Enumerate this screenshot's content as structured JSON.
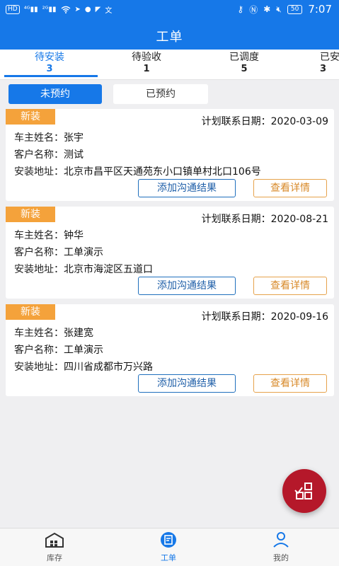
{
  "status_bar": {
    "left_items": [
      "HD",
      "4G",
      "26",
      "wifi",
      "msg",
      "send",
      "chat",
      "nav",
      "translate"
    ],
    "time": "7:07",
    "battery": "50"
  },
  "header": {
    "title": "工单"
  },
  "tabs": [
    {
      "label": "待安装",
      "count": "3",
      "active": true
    },
    {
      "label": "待验收",
      "count": "1",
      "active": false
    },
    {
      "label": "已调度",
      "count": "5",
      "active": false
    },
    {
      "label": "已安",
      "count": "3",
      "active": false
    }
  ],
  "subtabs": {
    "active": "未预约",
    "inactive": "已预约"
  },
  "orders": [
    {
      "badge": "新装",
      "plan_label": "计划联系日期：",
      "plan_date": "2020-03-09",
      "owner_label": "车主姓名：",
      "owner": "张宇",
      "customer_label": "客户名称：",
      "customer": "测试",
      "address_label": "安装地址：",
      "address": "北京市昌平区天通苑东小口镇单村北口106号",
      "btn_comm": "添加沟通结果",
      "btn_detail": "查看详情"
    },
    {
      "badge": "新装",
      "plan_label": "计划联系日期：",
      "plan_date": "2020-08-21",
      "owner_label": "车主姓名：",
      "owner": "钟华",
      "customer_label": "客户名称：",
      "customer": "工单演示",
      "address_label": "安装地址：",
      "address": "北京市海淀区五道口",
      "btn_comm": "添加沟通结果",
      "btn_detail": "查看详情"
    },
    {
      "badge": "新装",
      "plan_label": "计划联系日期：",
      "plan_date": "2020-09-16",
      "owner_label": "车主姓名：",
      "owner": "张建宽",
      "customer_label": "客户名称：",
      "customer": "工单演示",
      "address_label": "安装地址：",
      "address": "四川省成都市万兴路",
      "btn_comm": "添加沟通结果",
      "btn_detail": "查看详情"
    }
  ],
  "bottom_nav": [
    {
      "label": "库存",
      "icon": "warehouse-icon",
      "active": false
    },
    {
      "label": "工单",
      "icon": "workorder-icon",
      "active": true
    },
    {
      "label": "我的",
      "icon": "user-icon",
      "active": false
    }
  ],
  "colors": {
    "primary": "#1678e8",
    "badge": "#f4a23b",
    "fab": "#b5182a"
  }
}
